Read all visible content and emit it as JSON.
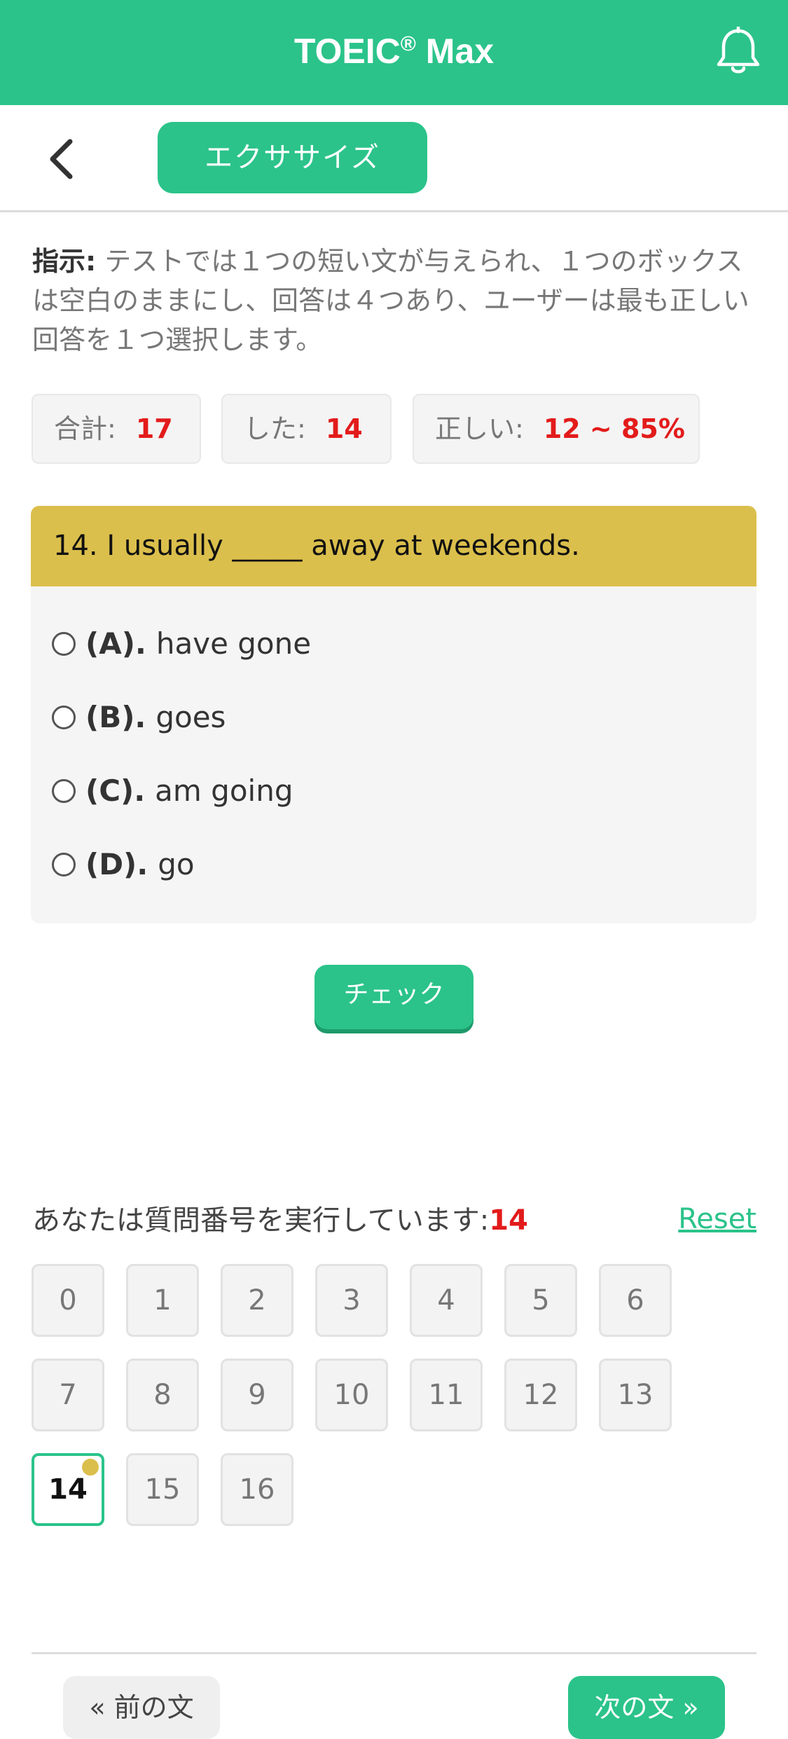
{
  "header": {
    "title": "TOEIC",
    "title_reg": "®",
    "title_suffix": " Max",
    "bell_icon": "bell-icon",
    "brand_color": "#2bc38a"
  },
  "subheader": {
    "back_icon": "chevron-left-icon",
    "tab_label": "エクササイズ"
  },
  "instruction": {
    "label": "指示:",
    "text": " テストでは１つの短い文が与えられ、１つのボックスは空白のままにし、回答は４つあり、ユーザーは最も正しい回答を１つ選択します。"
  },
  "stats": {
    "total_label": "合計:",
    "total_value": "17",
    "done_label": "した:",
    "done_value": "14",
    "correct_label": "正しい:",
    "correct_value": "12 ~ 85%"
  },
  "question": {
    "text": "14. I usually _____ away at weekends.",
    "header_color": "#dbbf4c",
    "options": [
      {
        "letter": "(A).",
        "text": "have gone"
      },
      {
        "letter": "(B).",
        "text": "goes"
      },
      {
        "letter": "(C).",
        "text": "am going"
      },
      {
        "letter": "(D).",
        "text": "go"
      }
    ]
  },
  "check_label": "チェック",
  "progress": {
    "label": "あなたは質問番号を実行しています:",
    "current": "14",
    "reset_label": "Reset",
    "numbers": [
      "0",
      "1",
      "2",
      "3",
      "4",
      "5",
      "6",
      "7",
      "8",
      "9",
      "10",
      "11",
      "12",
      "13",
      "14",
      "15",
      "16"
    ]
  },
  "nav": {
    "prev_label": "« 前の文",
    "next_label": "次の文 »"
  }
}
